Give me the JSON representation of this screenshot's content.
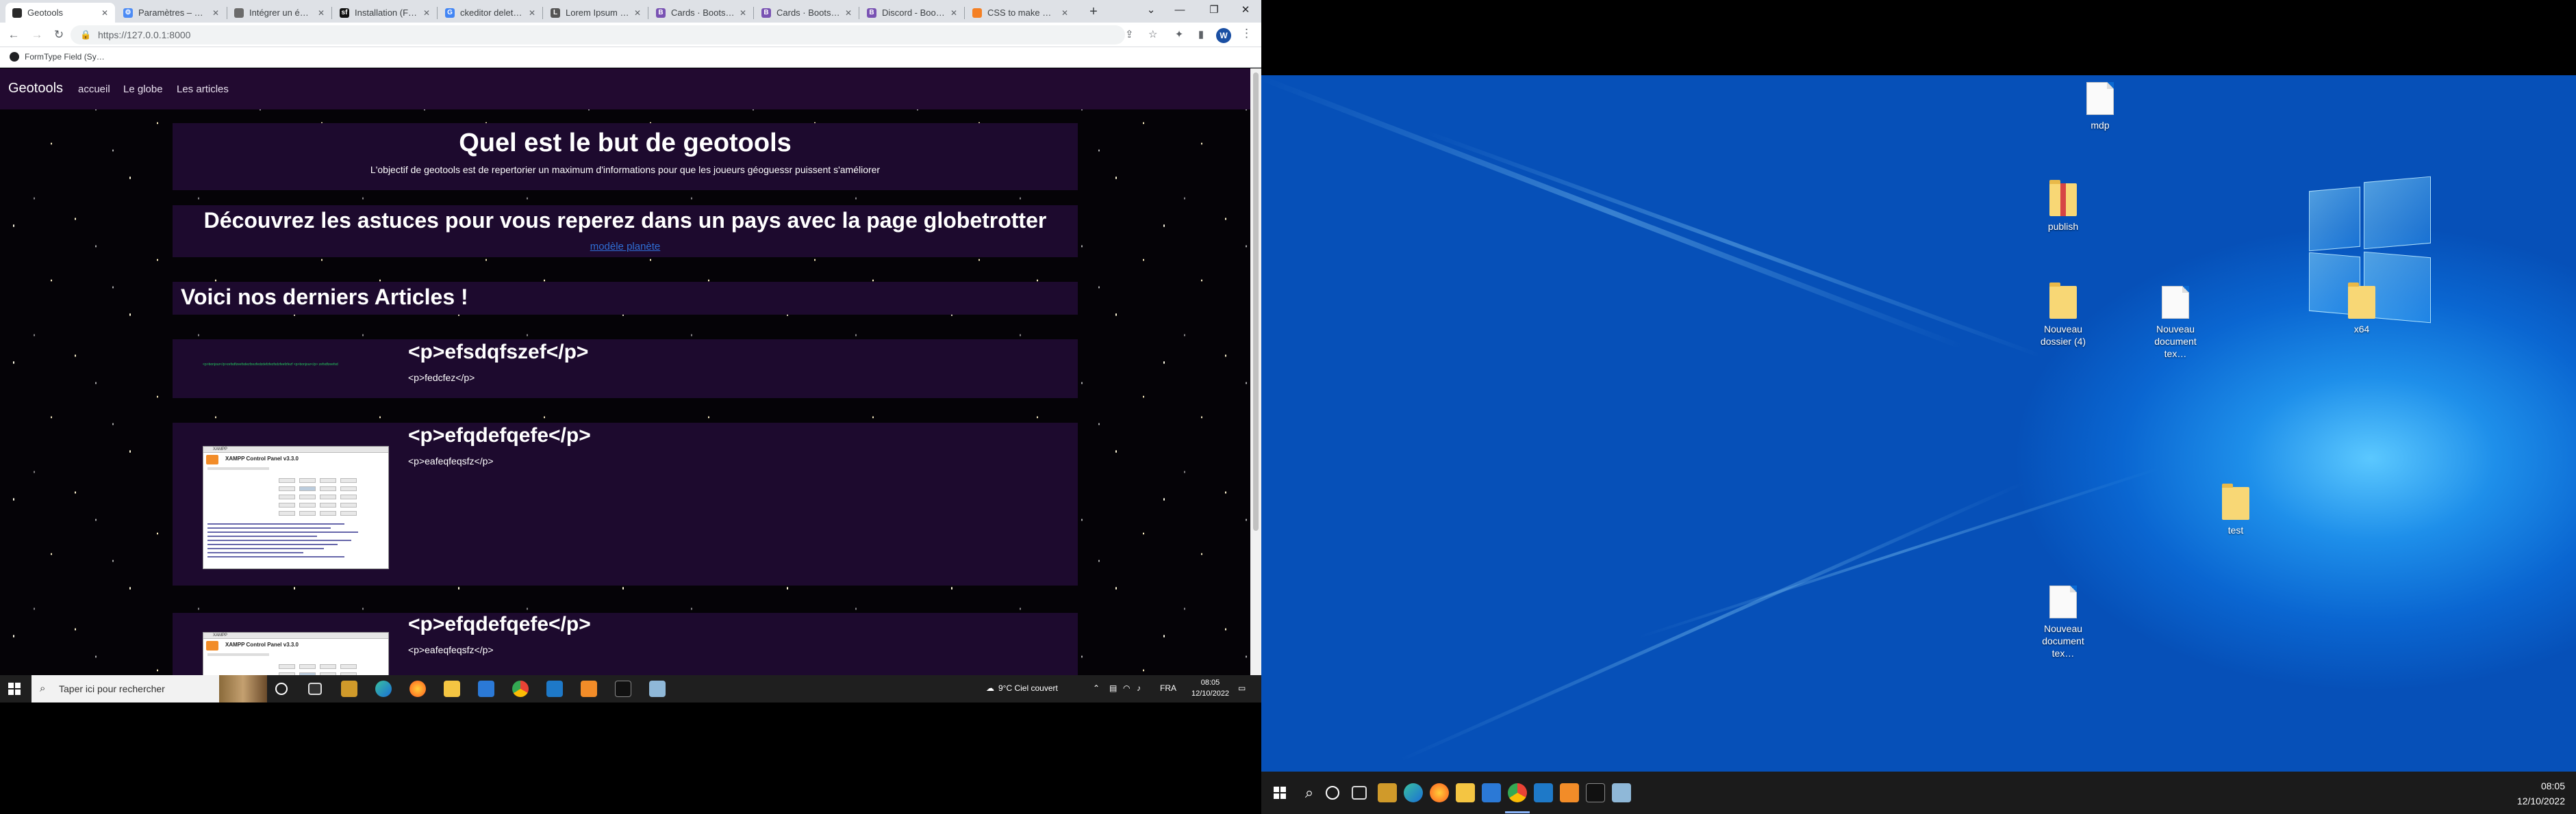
{
  "browser": {
    "tabs": [
      {
        "label": "Geotools",
        "fav_color": "#2a2a2a",
        "active": true
      },
      {
        "label": "Paramètres – Co…",
        "fav_color": "#4c8bf5"
      },
      {
        "label": "Intégrer un éditi…",
        "fav_color": "#6b6b6b"
      },
      {
        "label": "Installation (FOS…",
        "fav_color": "#111111"
      },
      {
        "label": "ckeditor delete t…",
        "fav_color": "#4285f4"
      },
      {
        "label": "Lorem Ipsum – Al…",
        "fav_color": "#555555"
      },
      {
        "label": "Cards · Bootstrap",
        "fav_color": "#7952b3"
      },
      {
        "label": "Cards · Bootstrap",
        "fav_color": "#7952b3"
      },
      {
        "label": "Discord - Bootstr…",
        "fav_color": "#7952b3"
      },
      {
        "label": "CSS to make HTM…",
        "fav_color": "#f48024"
      }
    ],
    "url": "https://127.0.0.1:8000",
    "profile_initial": "W",
    "bookmark": "FormType Field (Sy…"
  },
  "site": {
    "brand": "Geotools",
    "nav": [
      "accueil",
      "Le globe",
      "Les articles"
    ],
    "hero_title": "Quel est le but de geotools",
    "hero_text": "L'objectif de geotools est de repertorier un maximum d'informations pour que les joueurs géoguessr puissent s'améliorer",
    "globe_title": "Découvrez les astuces pour vous reperez dans un pays avec la page globetrotter",
    "globe_img_alt": "modèle planète",
    "articles_title": "Voici nos derniers Articles !",
    "articles": [
      {
        "title": "<p>efsdqfszef</p>",
        "text": "<p>fedcfez</p>",
        "img_text": "<p>bonjour</p>zefsdfzeefsdezfzezfedzdefzfezfsdzfeefzfezf <p>bonjour</p> zefsdfzeefsd"
      },
      {
        "title": "<p>efqdefqefe</p>",
        "text": "<p>eafeqfeqsfz</p>",
        "img_title": "XAMPP Control Panel v3.3.0"
      },
      {
        "title": "<p>efqdefqefe</p>",
        "text": "<p>eafeqfeqsfz</p>",
        "img_title": "XAMPP Control Panel v3.3.0"
      }
    ]
  },
  "taskbar_left": {
    "search_placeholder": "Taper ici pour rechercher",
    "weather": "9°C  Ciel couvert",
    "lang": "FRA",
    "time": "08:05",
    "date": "12/10/2022"
  },
  "desktop": {
    "icons": [
      {
        "label": "mdp",
        "type": "doc"
      },
      {
        "label": "publish",
        "type": "zip"
      },
      {
        "label": "Nouveau dossier (4)",
        "type": "folder"
      },
      {
        "label": "Nouveau document tex…",
        "type": "doc"
      },
      {
        "label": "x64",
        "type": "folder"
      },
      {
        "label": "test",
        "type": "folder"
      },
      {
        "label": "Nouveau document tex…",
        "type": "doc"
      }
    ],
    "clock_time": "08:05",
    "clock_date": "12/10/2022"
  }
}
